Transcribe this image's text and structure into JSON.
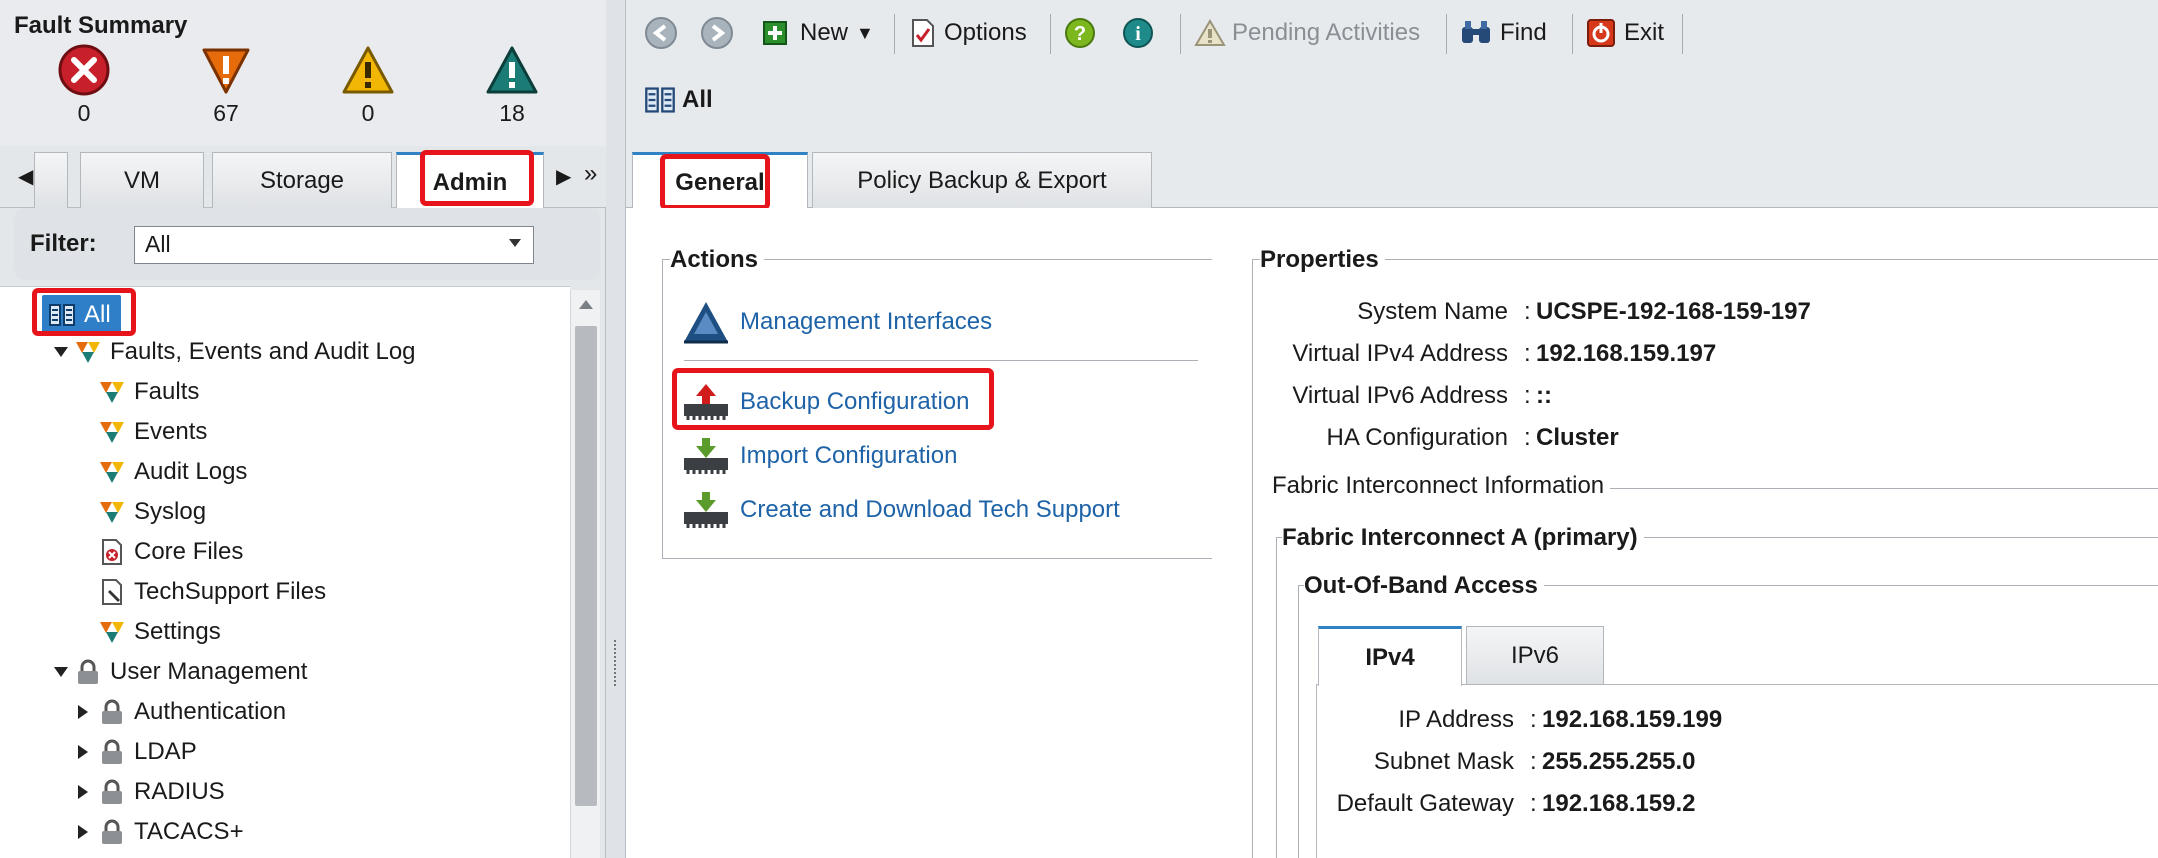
{
  "fault_summary": {
    "title": "Fault Summary",
    "items": [
      {
        "icon": "critical-icon",
        "count": "0",
        "color": "#c8202b"
      },
      {
        "icon": "major-icon",
        "count": "67",
        "color": "#e66b0a"
      },
      {
        "icon": "minor-icon",
        "count": "0",
        "color": "#f2b705"
      },
      {
        "icon": "warning-icon",
        "count": "18",
        "color": "#1b7b75"
      }
    ]
  },
  "left_tabs": {
    "tabs": [
      {
        "label": "VM"
      },
      {
        "label": "Storage"
      },
      {
        "label": "Admin"
      }
    ],
    "active": "Admin"
  },
  "filter": {
    "label": "Filter:",
    "value": "All"
  },
  "tree": {
    "items": [
      {
        "label": "All"
      },
      {
        "label": "Faults, Events and Audit Log"
      },
      {
        "label": "Faults"
      },
      {
        "label": "Events"
      },
      {
        "label": "Audit Logs"
      },
      {
        "label": "Syslog"
      },
      {
        "label": "Core Files"
      },
      {
        "label": "TechSupport Files"
      },
      {
        "label": "Settings"
      },
      {
        "label": "User Management"
      },
      {
        "label": "Authentication"
      },
      {
        "label": "LDAP"
      },
      {
        "label": "RADIUS"
      },
      {
        "label": "TACACS+"
      }
    ]
  },
  "toolbar": {
    "new_label": "New",
    "options_label": "Options",
    "pending_label": "Pending Activities",
    "find_label": "Find",
    "exit_label": "Exit"
  },
  "breadcrumb": {
    "label": "All"
  },
  "right_tabs": {
    "tabs": [
      {
        "label": "General"
      },
      {
        "label": "Policy Backup & Export"
      }
    ],
    "active": "General"
  },
  "actions": {
    "title": "Actions",
    "items": [
      {
        "label": "Management Interfaces"
      },
      {
        "label": "Backup Configuration"
      },
      {
        "label": "Import Configuration"
      },
      {
        "label": "Create and Download Tech Support"
      }
    ]
  },
  "properties": {
    "title": "Properties",
    "rows": [
      {
        "label": "System Name",
        "value": "UCSPE-192-168-159-197"
      },
      {
        "label": "Virtual IPv4 Address",
        "value": "192.168.159.197"
      },
      {
        "label": "Virtual IPv6 Address",
        "value": "::"
      },
      {
        "label": "HA Configuration",
        "value": "Cluster"
      }
    ],
    "fabric_info_title": "Fabric Interconnect Information",
    "fabric_a_title": "Fabric Interconnect A (primary)",
    "oob_title": "Out-Of-Band Access",
    "ip_tabs": [
      {
        "label": "IPv4"
      },
      {
        "label": "IPv6"
      }
    ],
    "ip_rows": [
      {
        "label": "IP Address",
        "value": "192.168.159.199"
      },
      {
        "label": "Subnet Mask",
        "value": "255.255.255.0"
      },
      {
        "label": "Default Gateway",
        "value": "192.168.159.2"
      }
    ]
  },
  "colors": {
    "highlight": "#e8141c",
    "tab_accent": "#2f83c5",
    "link": "#1e63a8"
  }
}
